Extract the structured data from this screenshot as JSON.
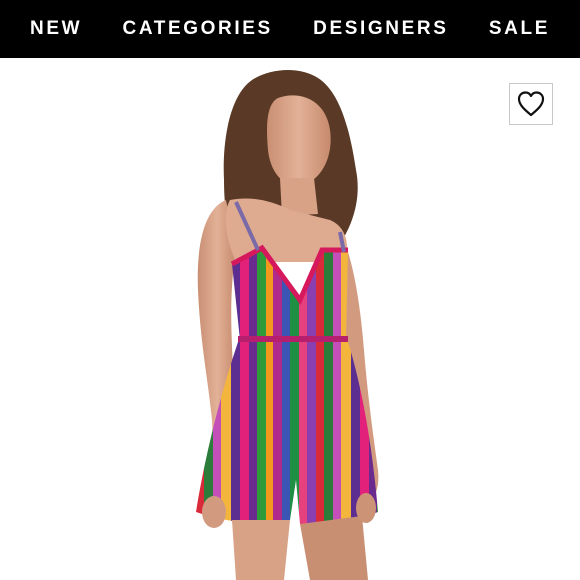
{
  "nav": {
    "items": [
      {
        "label": "NEW"
      },
      {
        "label": "CATEGORIES"
      },
      {
        "label": "DESIGNERS"
      },
      {
        "label": "SALE"
      }
    ]
  },
  "product": {
    "image_icon": "striped-romper-photo",
    "favorite_icon": "heart-outline-icon"
  },
  "colors": {
    "nav_background": "#000000",
    "nav_text": "#ffffff",
    "page_background": "#ffffff"
  }
}
